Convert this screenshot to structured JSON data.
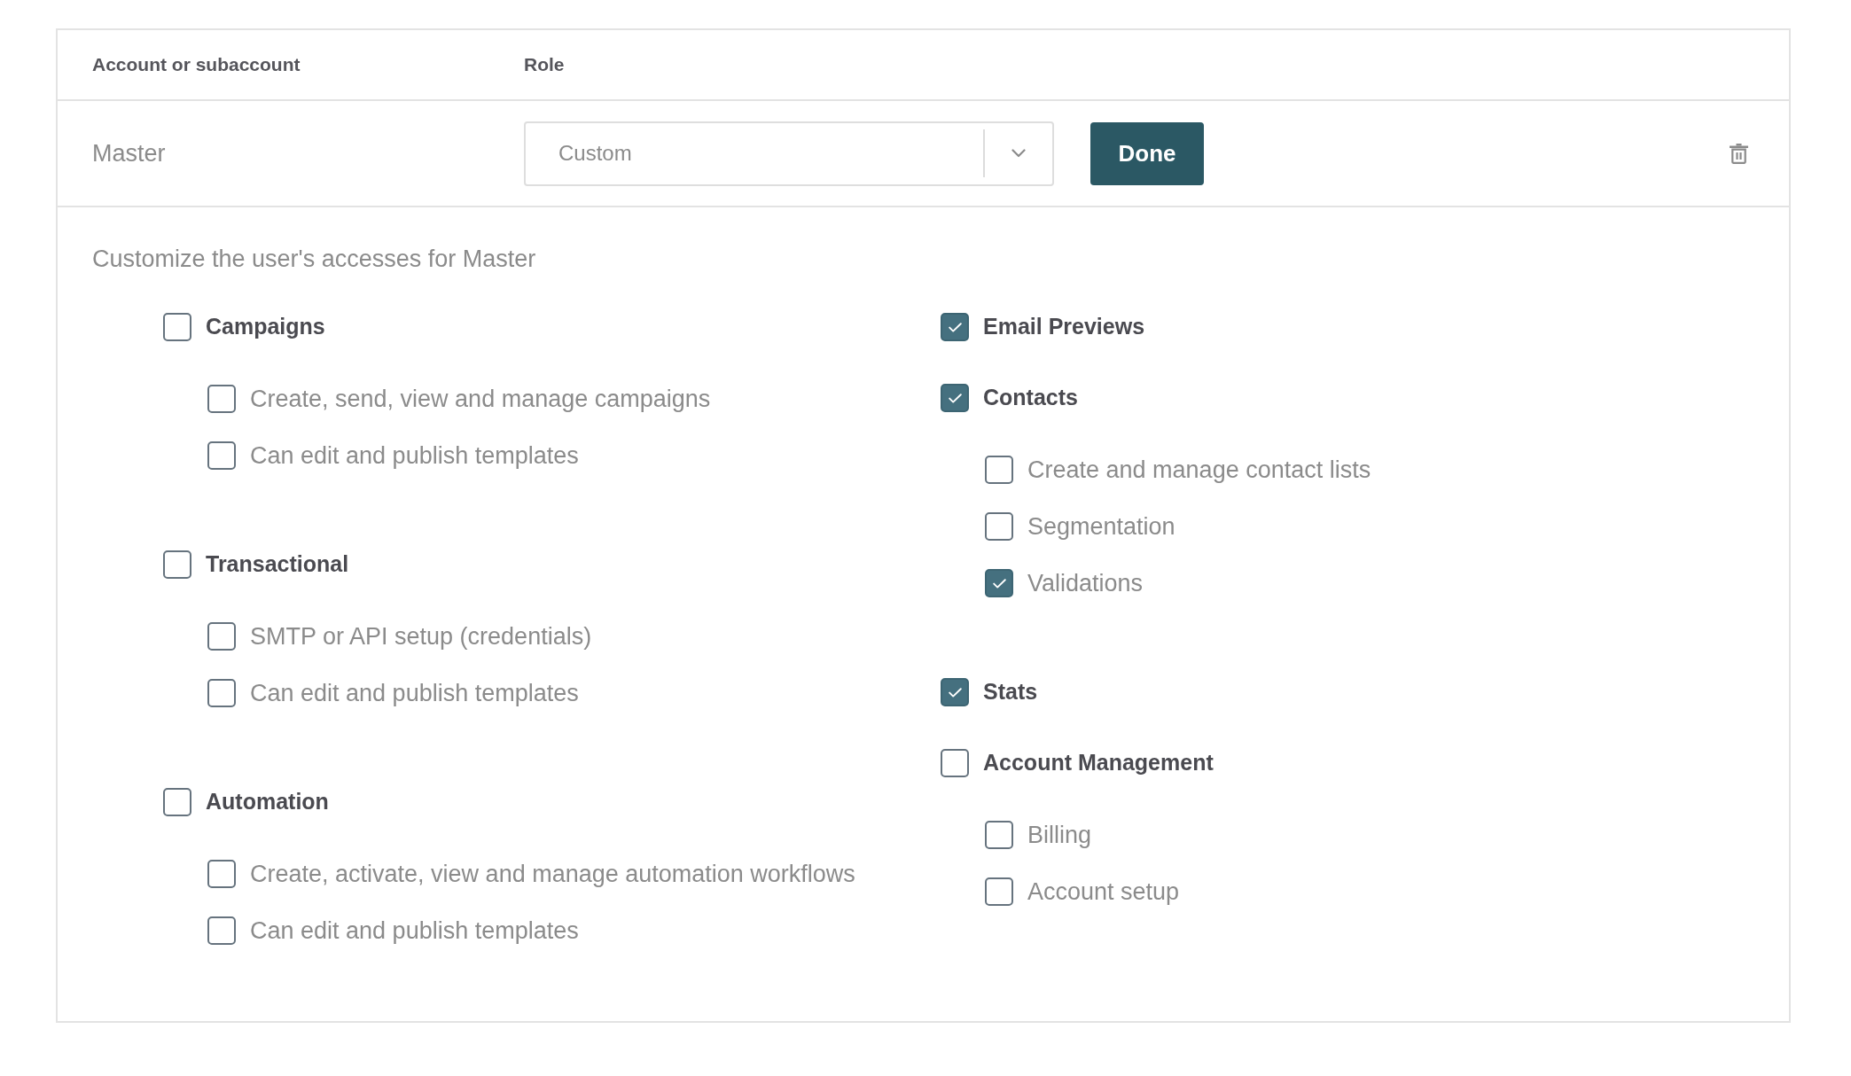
{
  "table": {
    "columns": [
      "Account or subaccount",
      "Role"
    ],
    "rows": [
      {
        "account": "Master",
        "role": {
          "value": "Custom"
        },
        "action": "Done"
      }
    ]
  },
  "permissions": {
    "intro": "Customize the user's accesses for Master",
    "columns": [
      {
        "groups": [
          {
            "label": "Campaigns",
            "checked": false,
            "children": [
              {
                "label": "Create, send, view and manage campaigns",
                "checked": false
              },
              {
                "label": "Can edit and publish templates",
                "checked": false
              }
            ]
          },
          {
            "label": "Transactional",
            "checked": false,
            "children": [
              {
                "label": "SMTP or API setup (credentials)",
                "checked": false
              },
              {
                "label": "Can edit and publish templates",
                "checked": false
              }
            ]
          },
          {
            "label": "Automation",
            "checked": false,
            "children": [
              {
                "label": "Create, activate, view and manage automation workflows",
                "checked": false
              },
              {
                "label": "Can edit and publish templates",
                "checked": false
              }
            ]
          }
        ]
      },
      {
        "groups": [
          {
            "label": "Email Previews",
            "checked": true
          },
          {
            "label": "Contacts",
            "checked": true,
            "children": [
              {
                "label": "Create and manage contact lists",
                "checked": false
              },
              {
                "label": "Segmentation",
                "checked": false
              },
              {
                "label": "Validations",
                "checked": true
              }
            ]
          },
          {
            "label": "Stats",
            "checked": true
          },
          {
            "label": "Account Management",
            "checked": false,
            "children": [
              {
                "label": "Billing",
                "checked": false
              },
              {
                "label": "Account setup",
                "checked": false
              }
            ]
          }
        ]
      }
    ]
  }
}
